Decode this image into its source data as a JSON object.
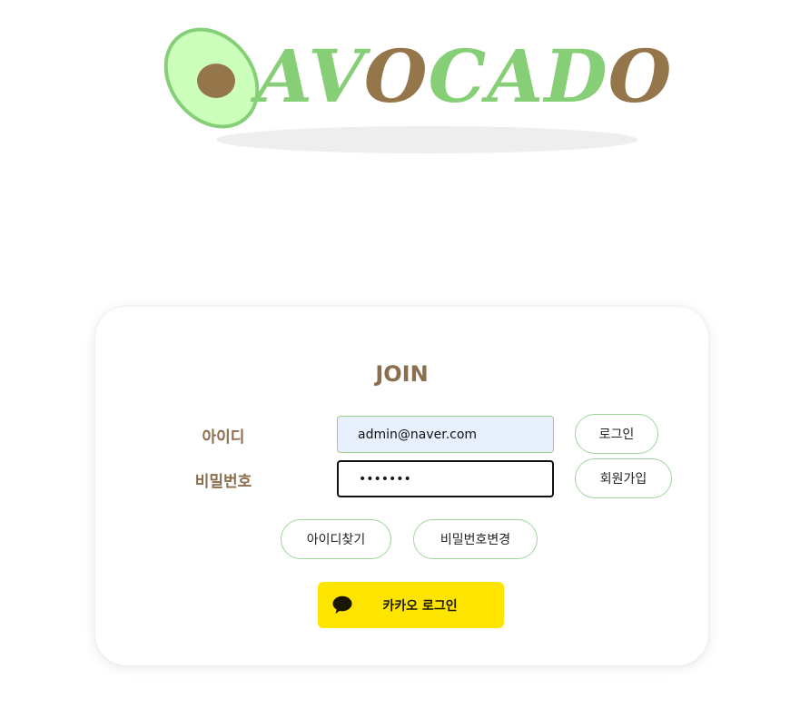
{
  "logo": {
    "text_part1": "A",
    "text_part2": "V",
    "text_part3": "O",
    "text_part4": "CAD",
    "text_part5": "O",
    "colors": {
      "green": "#86cf76",
      "brown": "#94764a",
      "avocado_fill": "#ccffbb"
    }
  },
  "form": {
    "title": "JOIN",
    "id_label": "아이디",
    "password_label": "비밀번호",
    "id_value": "admin@naver.com",
    "password_value": "•••••••",
    "login_button": "로그인",
    "signup_button": "회원가입",
    "find_id_button": "아이디찾기",
    "change_password_button": "비밀번호변경",
    "kakao_login_button": "카카오 로그인"
  },
  "colors": {
    "label_brown": "#8b6e4e",
    "pill_border": "#9fd59a",
    "kakao_yellow": "#fee500",
    "autofill_bg": "#e8f0fe"
  }
}
